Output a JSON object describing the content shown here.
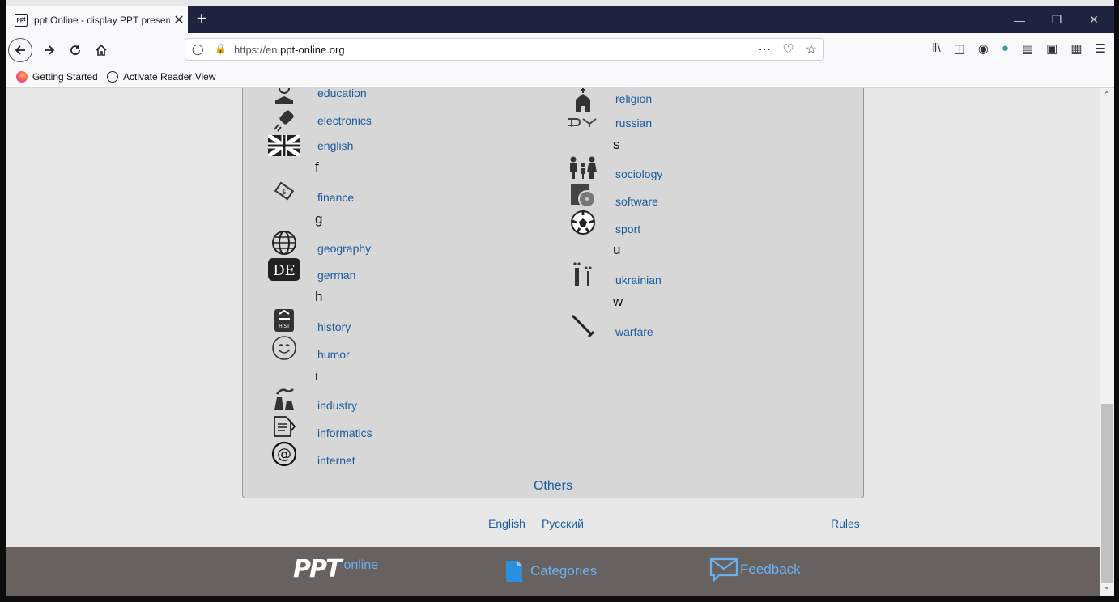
{
  "browser": {
    "tab_title": "ppt Online - display PPT presen",
    "tab_icon_text": "ppt",
    "tab_close": "✕",
    "new_tab": "+",
    "url_prefix": "https://en.",
    "url_domain": "ppt-online.org",
    "bookmarks": [
      {
        "label": "Getting Started"
      },
      {
        "label": "Activate Reader View"
      }
    ]
  },
  "categories_left": [
    {
      "letter": "",
      "name": "education",
      "icon": "education-icon"
    },
    {
      "letter": "",
      "name": "electronics",
      "icon": "electronics-icon"
    },
    {
      "letter": "",
      "name": "english",
      "icon": "uk-flag-icon"
    },
    {
      "letter": "f",
      "name": "finance",
      "icon": "finance-icon"
    },
    {
      "letter": "g",
      "name": "geography",
      "icon": "globe-icon"
    },
    {
      "letter": "",
      "name": "german",
      "icon": "de-icon"
    },
    {
      "letter": "h",
      "name": "history",
      "icon": "history-icon"
    },
    {
      "letter": "",
      "name": "humor",
      "icon": "smiley-icon"
    },
    {
      "letter": "i",
      "name": "industry",
      "icon": "factory-icon"
    },
    {
      "letter": "",
      "name": "informatics",
      "icon": "informatics-icon"
    },
    {
      "letter": "",
      "name": "internet",
      "icon": "at-icon"
    }
  ],
  "categories_right": [
    {
      "letter": "",
      "name": "religion",
      "icon": "church-icon"
    },
    {
      "letter": "",
      "name": "russian",
      "icon": "russian-icon"
    },
    {
      "letter": "s",
      "name": "sociology",
      "icon": "family-icon"
    },
    {
      "letter": "",
      "name": "software",
      "icon": "software-icon"
    },
    {
      "letter": "",
      "name": "sport",
      "icon": "ball-icon"
    },
    {
      "letter": "u",
      "name": "ukrainian",
      "icon": "ukrainian-icon"
    },
    {
      "letter": "w",
      "name": "warfare",
      "icon": "sword-icon"
    }
  ],
  "letters": {
    "f": "f",
    "g": "g",
    "h": "h",
    "i": "i",
    "s": "s",
    "u": "u",
    "w": "w"
  },
  "icon_glyphs": {
    "russian": "РУ",
    "german": "DE",
    "internet": "@",
    "history": "HIST"
  },
  "others_label": "Others",
  "footer": {
    "english": "English",
    "russian": "Русский",
    "rules": "Rules"
  },
  "bottom_bar": {
    "logo": "PPT",
    "logo_suffix": "online",
    "categories": "Categories",
    "feedback": "Feedback"
  },
  "colors": {
    "link": "#1a5c9e",
    "bottom_bar": "#676260",
    "panel": "#d7d7d7"
  }
}
